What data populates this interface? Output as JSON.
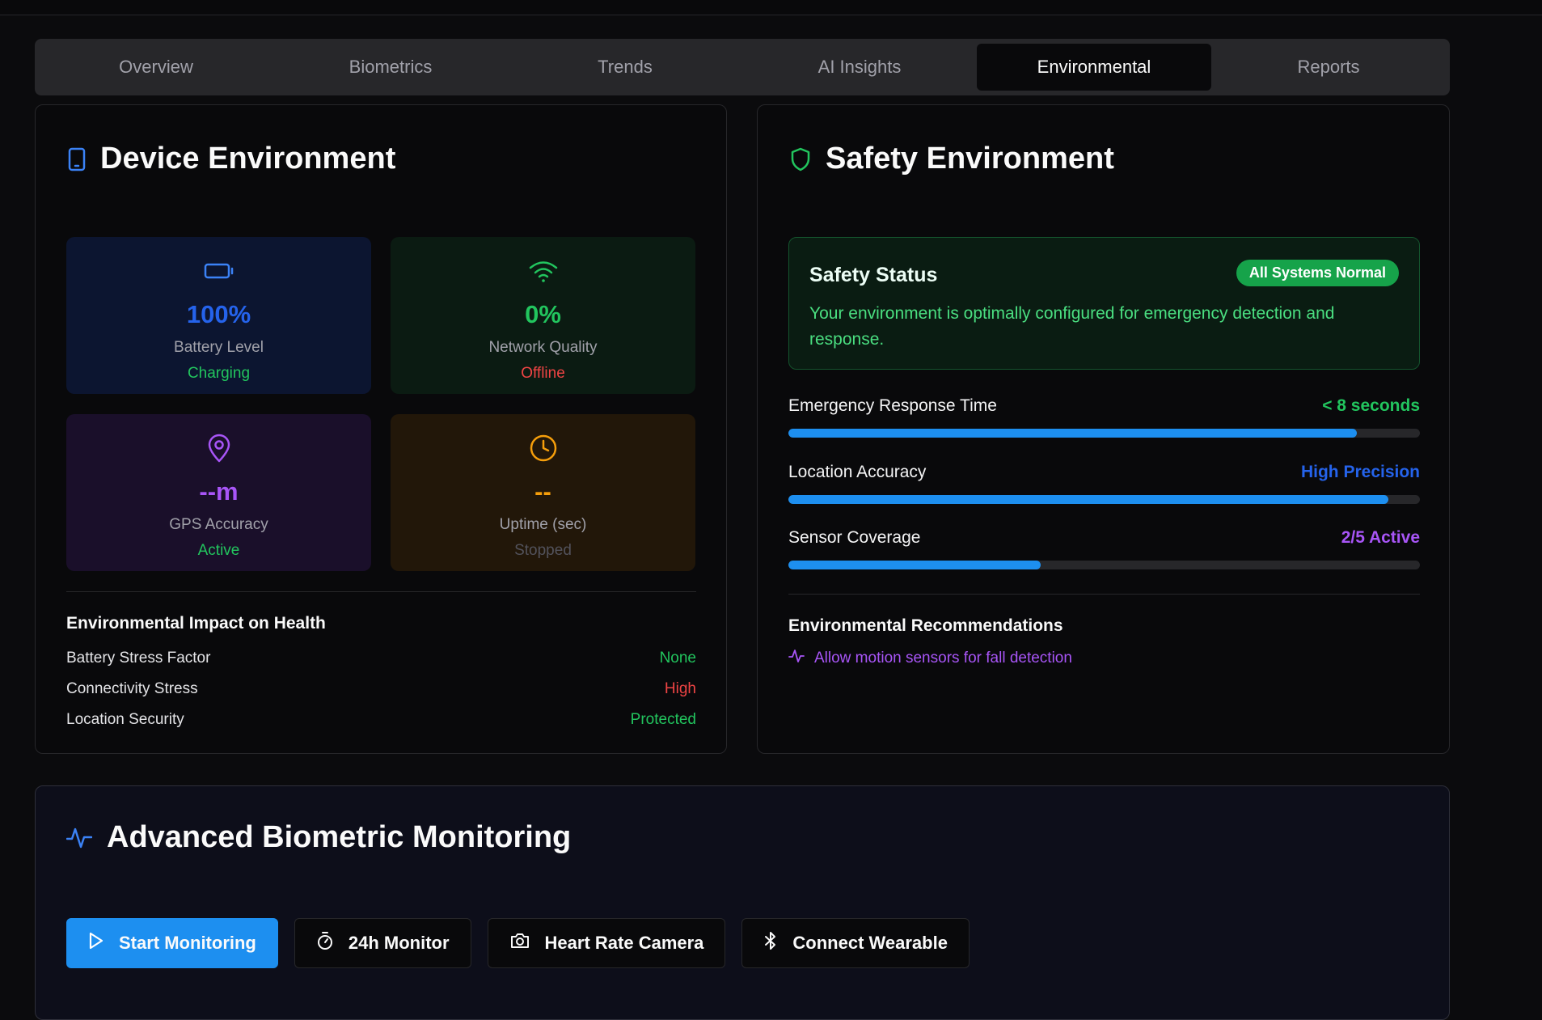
{
  "tabs": [
    "Overview",
    "Biometrics",
    "Trends",
    "AI Insights",
    "Environmental",
    "Reports"
  ],
  "active_tab": "Environmental",
  "device": {
    "title": "Device Environment",
    "tiles": {
      "battery": {
        "value": "100%",
        "label": "Battery Level",
        "status": "Charging",
        "color": "#2563eb",
        "status_color": "#22c55e"
      },
      "network": {
        "value": "0%",
        "label": "Network Quality",
        "status": "Offline",
        "color": "#22c55e",
        "status_color": "#ef4444"
      },
      "gps": {
        "value": "--m",
        "label": "GPS Accuracy",
        "status": "Active",
        "color": "#a855f7",
        "status_color": "#22c55e"
      },
      "uptime": {
        "value": "--",
        "label": "Uptime (sec)",
        "status": "Stopped",
        "color": "#f59e0b",
        "status_color": "#52525b"
      }
    },
    "impact_title": "Environmental Impact on Health",
    "impact": [
      {
        "label": "Battery Stress Factor",
        "value": "None",
        "color": "#22c55e"
      },
      {
        "label": "Connectivity Stress",
        "value": "High",
        "color": "#ef4444"
      },
      {
        "label": "Location Security",
        "value": "Protected",
        "color": "#22c55e"
      }
    ]
  },
  "safety": {
    "title": "Safety Environment",
    "status_title": "Safety Status",
    "status_badge": "All Systems Normal",
    "status_text": "Your environment is optimally configured for emergency detection and response.",
    "metrics": [
      {
        "label": "Emergency Response Time",
        "value": "< 8 seconds",
        "color": "#22c55e",
        "progress": 0.9
      },
      {
        "label": "Location Accuracy",
        "value": "High Precision",
        "color": "#2563eb",
        "progress": 0.95
      },
      {
        "label": "Sensor Coverage",
        "value": "2/5 Active",
        "color": "#a855f7",
        "progress": 0.4
      }
    ],
    "recommendations_title": "Environmental Recommendations",
    "recommendations": [
      "Allow motion sensors for fall detection"
    ]
  },
  "monitoring": {
    "title": "Advanced Biometric Monitoring",
    "buttons": [
      "Start Monitoring",
      "24h Monitor",
      "Heart Rate Camera",
      "Connect Wearable"
    ]
  }
}
